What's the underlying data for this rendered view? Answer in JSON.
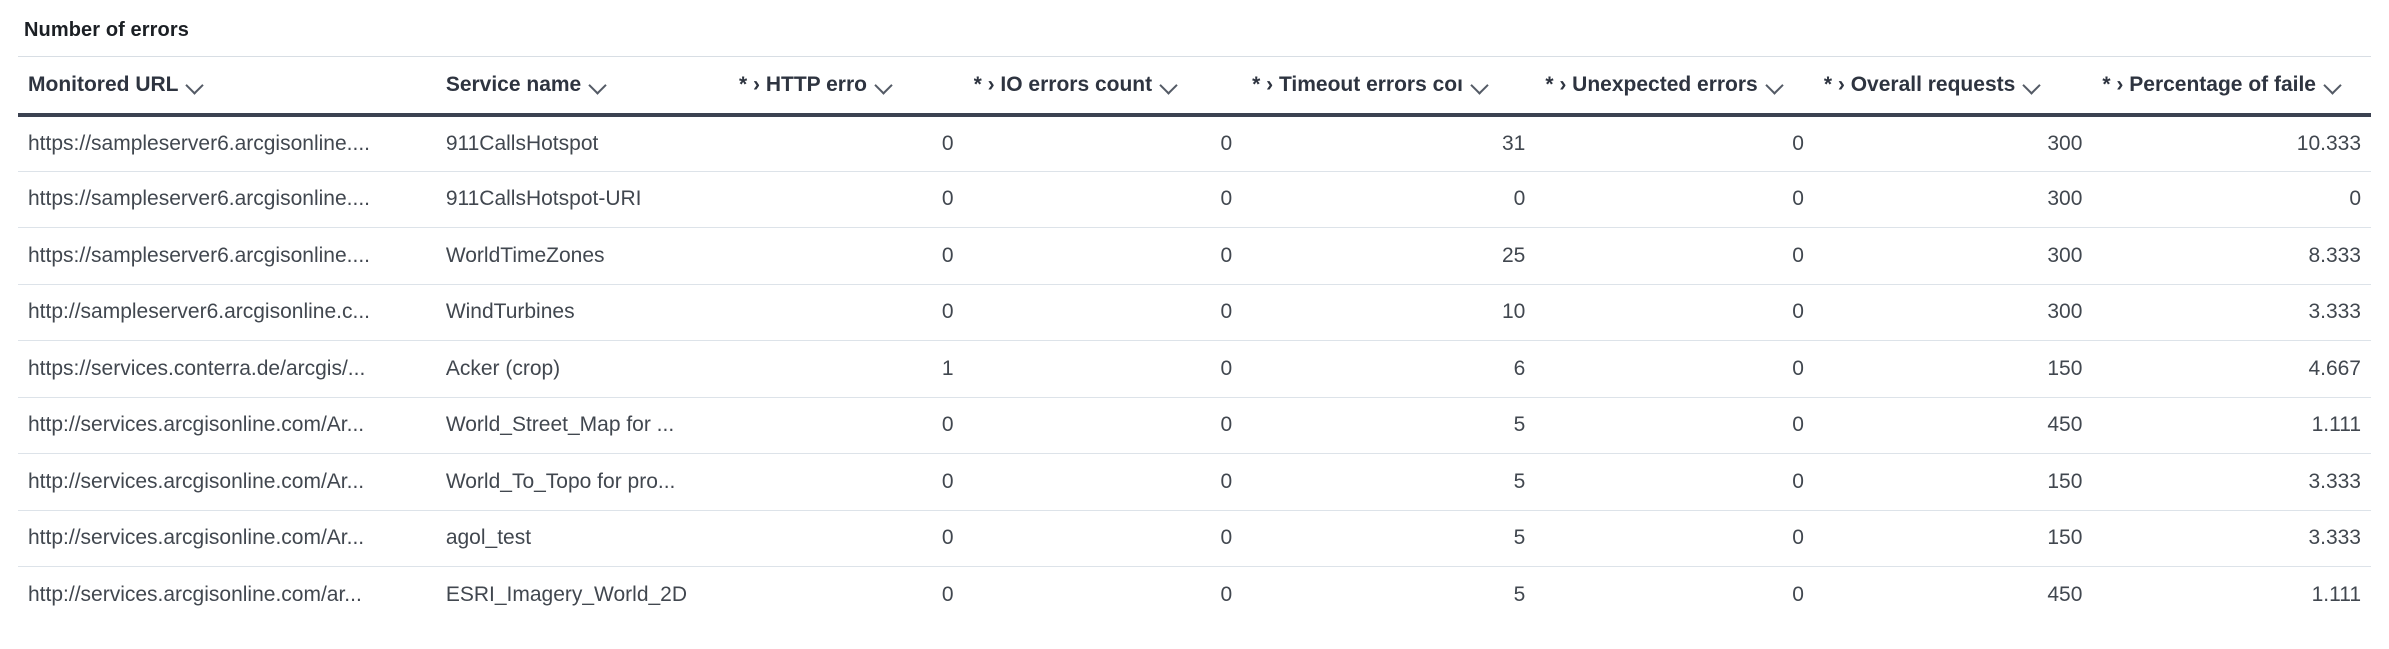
{
  "panel": {
    "title": "Number of errors"
  },
  "table": {
    "columns": [
      {
        "label": "Monitored URL",
        "align": "left",
        "sortable": true,
        "icon": "chevron-down-icon"
      },
      {
        "label": "Service name",
        "align": "left",
        "sortable": true,
        "icon": "chevron-down-icon"
      },
      {
        "label": "* › HTTP erro",
        "align": "right",
        "sortable": true,
        "icon": "chevron-down-icon"
      },
      {
        "label": "* › IO errors count",
        "align": "right",
        "sortable": true,
        "icon": "chevron-down-icon"
      },
      {
        "label": "* › Timeout errors coı",
        "align": "right",
        "sortable": true,
        "icon": "chevron-down-icon"
      },
      {
        "label": "* › Unexpected errors",
        "align": "right",
        "sortable": true,
        "icon": "chevron-down-icon"
      },
      {
        "label": "* › Overall requests",
        "align": "right",
        "sortable": true,
        "icon": "chevron-down-icon"
      },
      {
        "label": "* › Percentage of faile",
        "align": "right",
        "sortable": true,
        "icon": "chevron-down-icon"
      }
    ],
    "rows": [
      {
        "monitored_url": "https://sampleserver6.arcgisonline....",
        "service_name": "911CallsHotspot",
        "http_errors": "0",
        "io_errors": "0",
        "timeout_errors": "31",
        "unexpected_errors": "0",
        "overall_requests": "300",
        "percentage_failed": "10.333"
      },
      {
        "monitored_url": "https://sampleserver6.arcgisonline....",
        "service_name": "911CallsHotspot-URI",
        "http_errors": "0",
        "io_errors": "0",
        "timeout_errors": "0",
        "unexpected_errors": "0",
        "overall_requests": "300",
        "percentage_failed": "0"
      },
      {
        "monitored_url": "https://sampleserver6.arcgisonline....",
        "service_name": "WorldTimeZones",
        "http_errors": "0",
        "io_errors": "0",
        "timeout_errors": "25",
        "unexpected_errors": "0",
        "overall_requests": "300",
        "percentage_failed": "8.333"
      },
      {
        "monitored_url": "http://sampleserver6.arcgisonline.c...",
        "service_name": "WindTurbines",
        "http_errors": "0",
        "io_errors": "0",
        "timeout_errors": "10",
        "unexpected_errors": "0",
        "overall_requests": "300",
        "percentage_failed": "3.333"
      },
      {
        "monitored_url": "https://services.conterra.de/arcgis/...",
        "service_name": "Acker (crop)",
        "http_errors": "1",
        "io_errors": "0",
        "timeout_errors": "6",
        "unexpected_errors": "0",
        "overall_requests": "150",
        "percentage_failed": "4.667"
      },
      {
        "monitored_url": "http://services.arcgisonline.com/Ar...",
        "service_name": "World_Street_Map for ...",
        "http_errors": "0",
        "io_errors": "0",
        "timeout_errors": "5",
        "unexpected_errors": "0",
        "overall_requests": "450",
        "percentage_failed": "1.111"
      },
      {
        "monitored_url": "http://services.arcgisonline.com/Ar...",
        "service_name": "World_To_Topo for pro...",
        "http_errors": "0",
        "io_errors": "0",
        "timeout_errors": "5",
        "unexpected_errors": "0",
        "overall_requests": "150",
        "percentage_failed": "3.333"
      },
      {
        "monitored_url": "http://services.arcgisonline.com/Ar...",
        "service_name": "agol_test",
        "http_errors": "0",
        "io_errors": "0",
        "timeout_errors": "5",
        "unexpected_errors": "0",
        "overall_requests": "150",
        "percentage_failed": "3.333"
      },
      {
        "monitored_url": "http://services.arcgisonline.com/ar...",
        "service_name": "ESRI_Imagery_World_2D",
        "http_errors": "0",
        "io_errors": "0",
        "timeout_errors": "5",
        "unexpected_errors": "0",
        "overall_requests": "450",
        "percentage_failed": "1.111"
      }
    ]
  },
  "colors": {
    "header_text": "#2e3440",
    "cell_text": "#41474f",
    "percentage_text": "#13806b",
    "header_rule": "#3b4251",
    "row_divider": "#dde3e9"
  }
}
